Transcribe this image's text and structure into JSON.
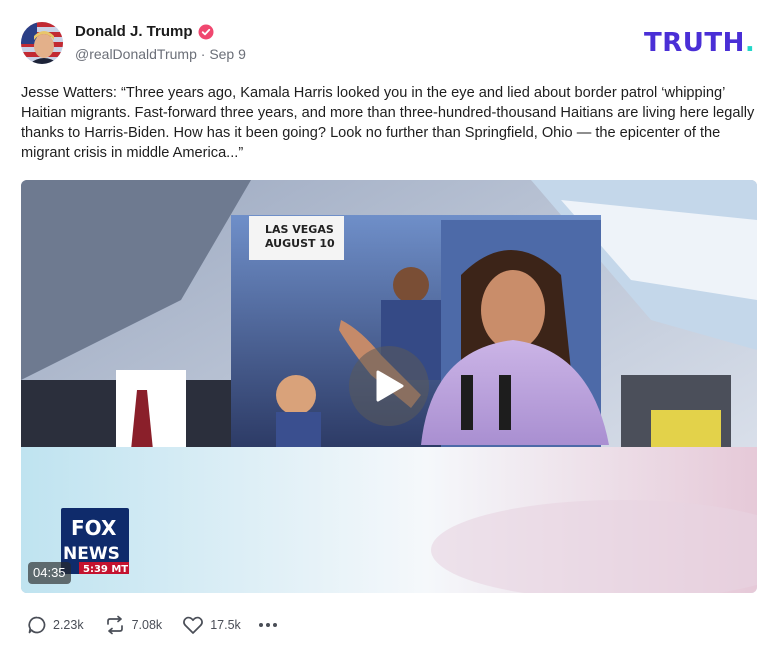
{
  "author": {
    "name": "Donald J. Trump",
    "handle": "@realDonaldTrump",
    "separator": "·",
    "date": "Sep 9"
  },
  "brand": {
    "logo_text": "TRUTH",
    "logo_dot": ".",
    "colors": {
      "primary": "#4a2fd6",
      "accent": "#22d7c9"
    }
  },
  "post": {
    "text": "Jesse Watters: “Three years ago, Kamala Harris looked you in the eye and lied about border patrol ‘whipping’ Haitian migrants. Fast-forward three years, and more than three-hundred-thousand Haitians are living here legally thanks to Harris-Biden. How has it been going? Look no further than Springfield, Ohio — the epicenter of the migrant crisis in middle America...”"
  },
  "video": {
    "duration": "04:35",
    "overlay_location": "LAS VEGAS",
    "overlay_date": "AUGUST 10",
    "network_logo_line1": "FOX",
    "network_logo_line2": "NEWS",
    "time_tag": "5:39 MT",
    "play_icon": "play-icon"
  },
  "stats": {
    "replies": "2.23k",
    "retruths": "7.08k",
    "likes": "17.5k"
  }
}
